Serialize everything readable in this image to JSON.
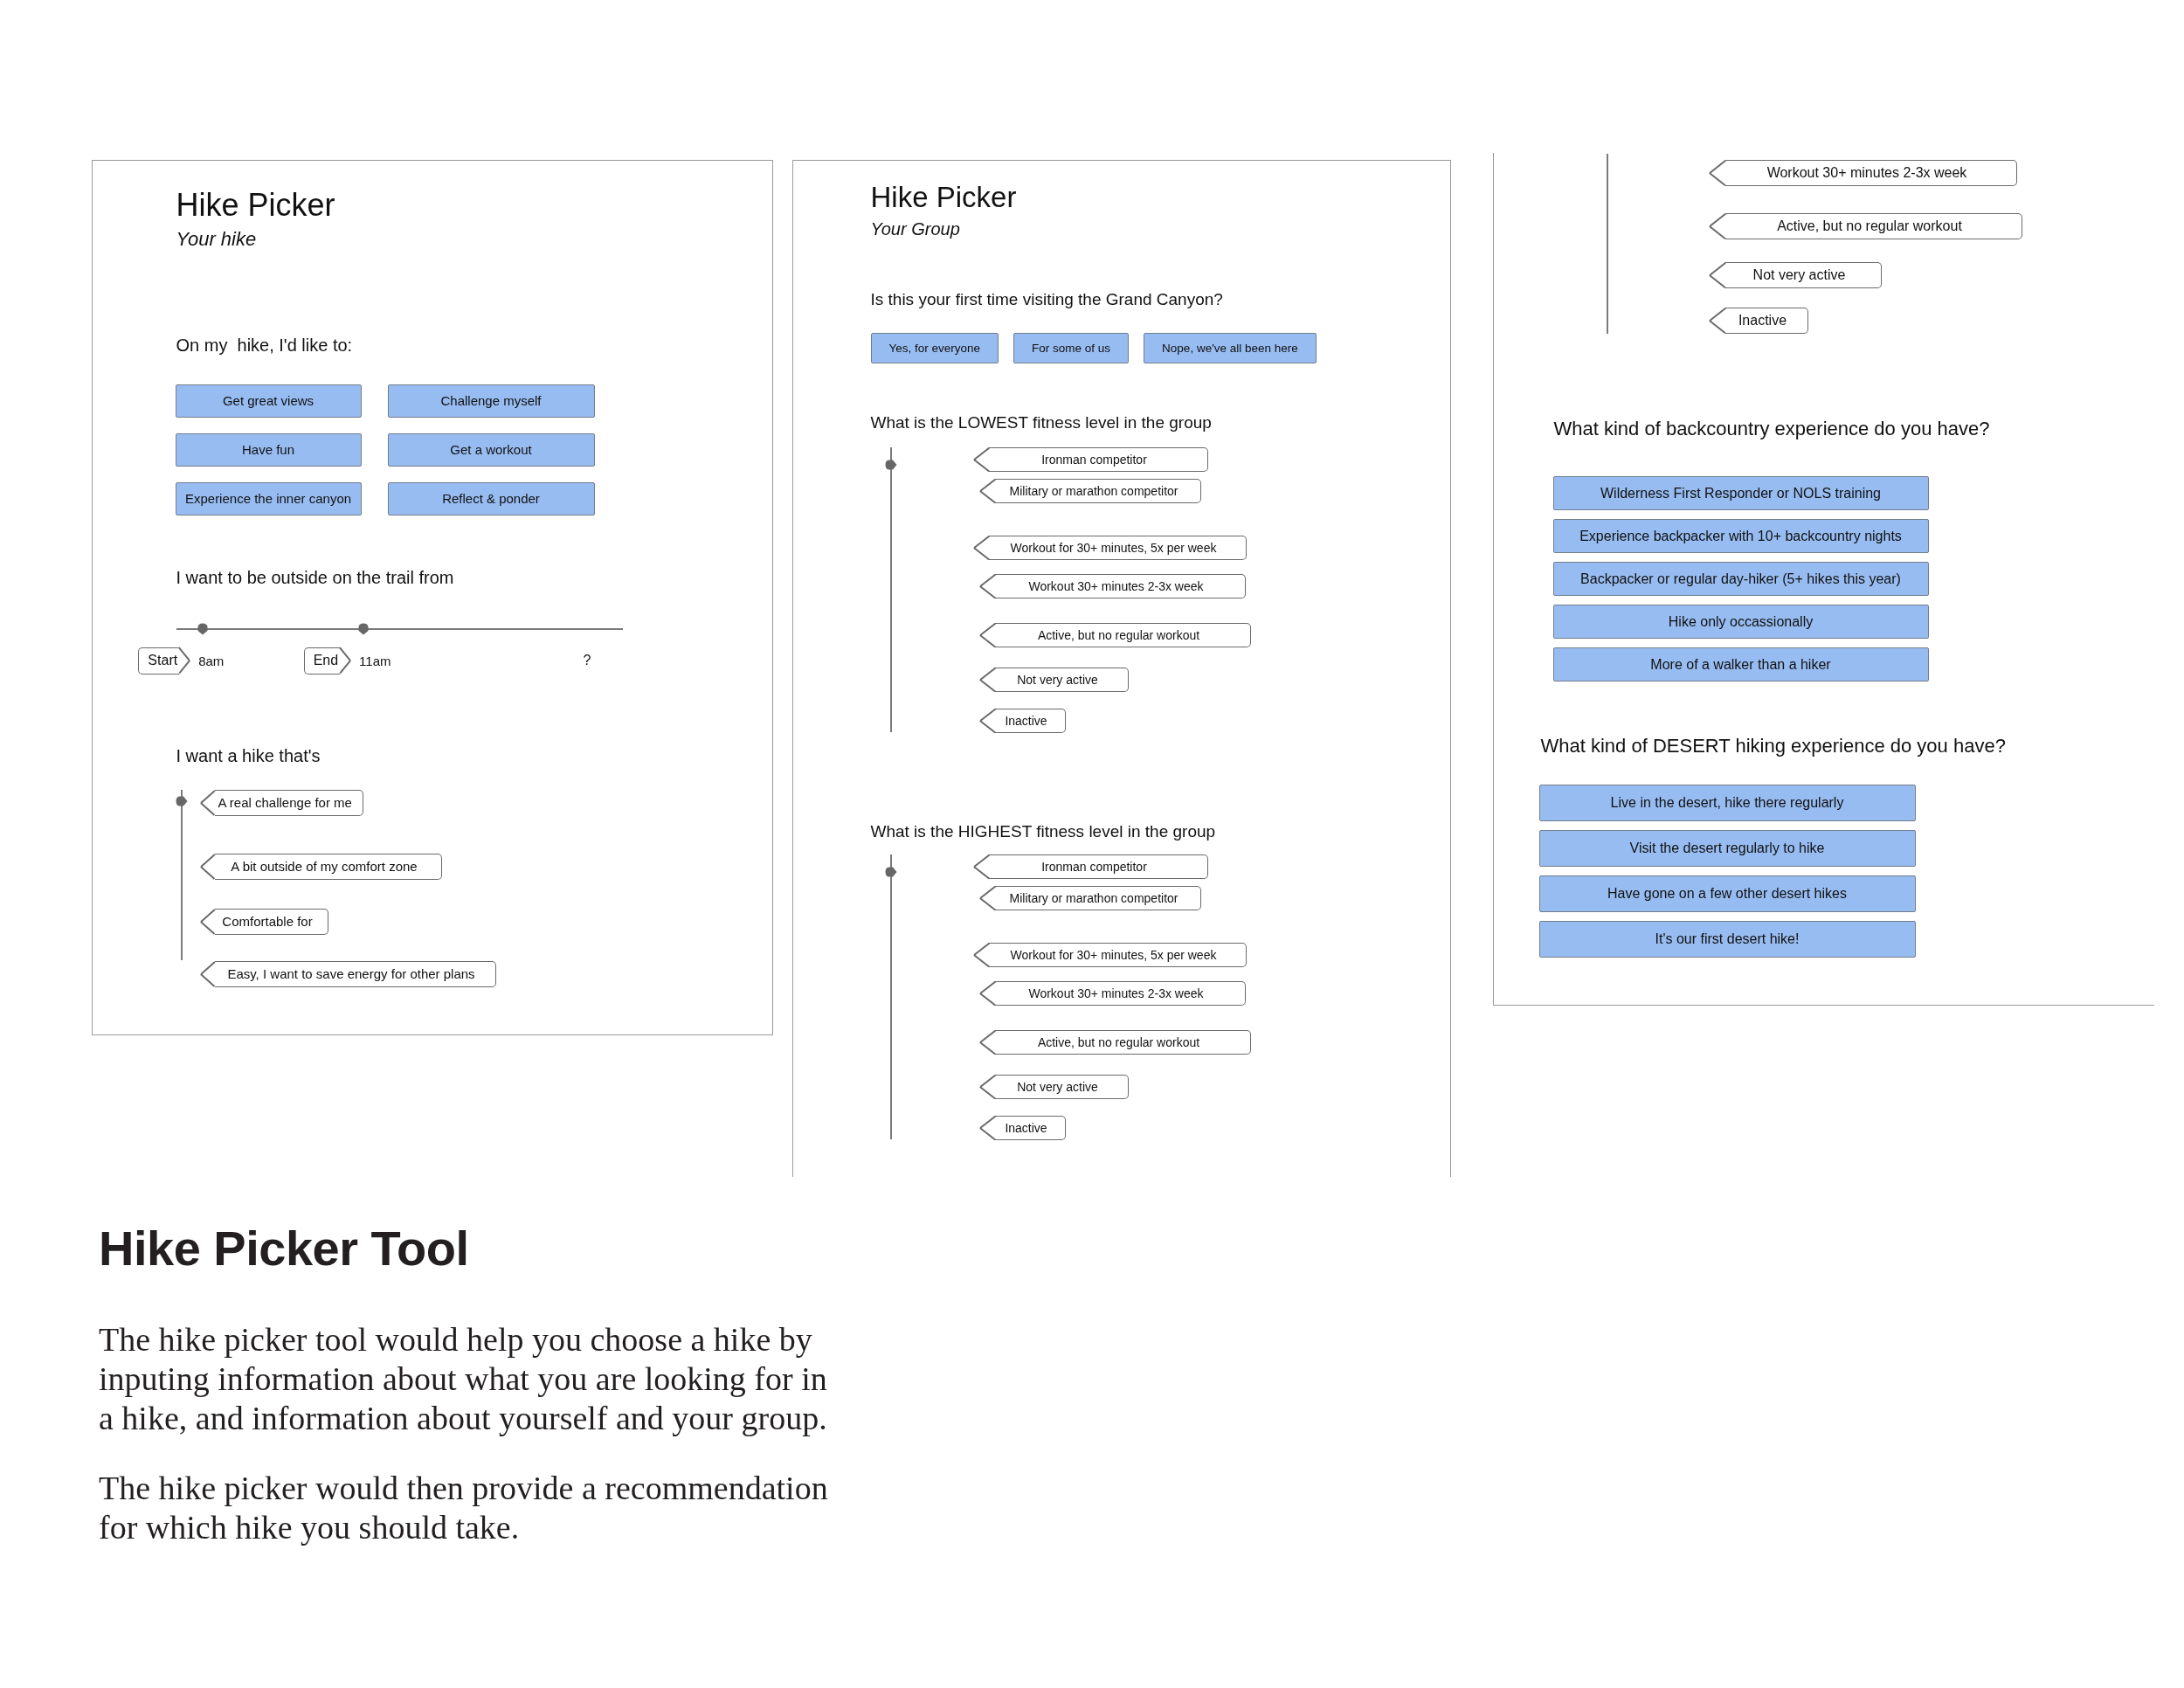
{
  "panel_1": {
    "title": "Hike Picker",
    "subtitle": "Your hike",
    "goals": {
      "question": "On my  hike, I'd like to:",
      "options": [
        "Get great views",
        "Challenge myself",
        "Have fun",
        "Get a workout",
        "Experience the inner canyon",
        "Reflect & ponder"
      ]
    },
    "time": {
      "question": "I want to be outside on the trail from",
      "handles": [
        {
          "label": "Start",
          "value": "8am",
          "level": 0.06
        },
        {
          "label": "End",
          "value": "11am",
          "level": 0.42
        }
      ],
      "end_value": "?"
    },
    "difficulty": {
      "question": "I want a hike that's",
      "level": 0.93,
      "options": [
        "A real challenge for me",
        "A bit outside of my comfort zone",
        "Comfortable for",
        "Easy, I want to save energy for other plans"
      ]
    }
  },
  "panel_2": {
    "title": "Hike Picker",
    "subtitle": "Your Group",
    "first_visit": {
      "question": "Is this your first time visiting the Grand Canyon?",
      "options": [
        "Yes, for everyone",
        "For some of us",
        "Nope, we've all been here"
      ]
    },
    "lowest_fitness": {
      "question": "What is the LOWEST fitness level in the group",
      "level": 0.94,
      "options": [
        "Ironman competitor",
        "Military or marathon competitor",
        "Workout for 30+ minutes, 5x per week",
        "Workout 30+ minutes 2-3x week",
        "Active, but no regular workout",
        "Not very active",
        "Inactive"
      ]
    },
    "highest_fitness": {
      "question": "What is the HIGHEST fitness level in the group",
      "level": 0.94,
      "options": [
        "Ironman competitor",
        "Military or marathon competitor",
        "Workout for 30+ minutes, 5x per week",
        "Workout 30+ minutes 2-3x week",
        "Active, but no regular workout",
        "Not very active",
        "Inactive"
      ]
    }
  },
  "panel_3": {
    "fitness_options": [
      "Workout 30+ minutes 2-3x week",
      "Active, but no regular workout",
      "Not very active",
      "Inactive"
    ],
    "backcountry": {
      "question": "What kind of backcountry experience do you have?",
      "options": [
        "Wilderness First Responder or NOLS training",
        "Experience backpacker with 10+ backcountry nights",
        "Backpacker or regular day-hiker (5+ hikes this year)",
        "Hike only occassionally",
        "More of a walker than a hiker"
      ]
    },
    "desert": {
      "question": "What kind of DESERT hiking experience do you have?",
      "options": [
        "Live in the desert, hike there regularly",
        "Visit the desert regularly to hike",
        "Have gone on a few other desert hikes",
        "It's our first desert hike!"
      ]
    }
  },
  "description": {
    "heading": "Hike Picker Tool",
    "paragraphs": [
      "The hike picker tool would help you choose a hike by inputing information about what you are looking for in a hike, and information about yourself and your group.",
      "The hike picker would then provide a recommendation for which hike you should take."
    ]
  }
}
